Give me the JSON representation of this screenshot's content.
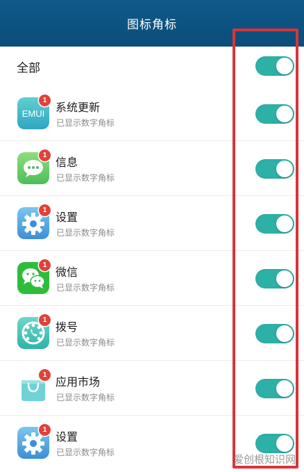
{
  "header": {
    "title": "图标角标"
  },
  "all_toggle": {
    "label": "全部",
    "on": true
  },
  "apps": [
    {
      "name": "系统更新",
      "status": "已显示数字角标",
      "badge": "1",
      "icon": "emui-icon",
      "on": true
    },
    {
      "name": "信息",
      "status": "已显示数字角标",
      "badge": "1",
      "icon": "message-icon",
      "on": true
    },
    {
      "name": "设置",
      "status": "已显示数字角标",
      "badge": "1",
      "icon": "gear-icon",
      "on": true
    },
    {
      "name": "微信",
      "status": "已显示数字角标",
      "badge": "1",
      "icon": "wechat-icon",
      "on": true
    },
    {
      "name": "拨号",
      "status": "已显示数字角标",
      "badge": "1",
      "icon": "dialer-icon",
      "on": true
    },
    {
      "name": "应用市场",
      "status": "已显示数字角标",
      "badge": "1",
      "icon": "app-market-icon",
      "on": true
    },
    {
      "name": "设置",
      "status": "已显示数字角标",
      "badge": "1",
      "icon": "gear-icon",
      "on": true
    }
  ],
  "colors": {
    "header_bg": "#0b4d79",
    "toggle_on": "#2db0a6",
    "badge": "#e0423a",
    "highlight": "#d9343a"
  },
  "watermark": "爱创根知识网"
}
